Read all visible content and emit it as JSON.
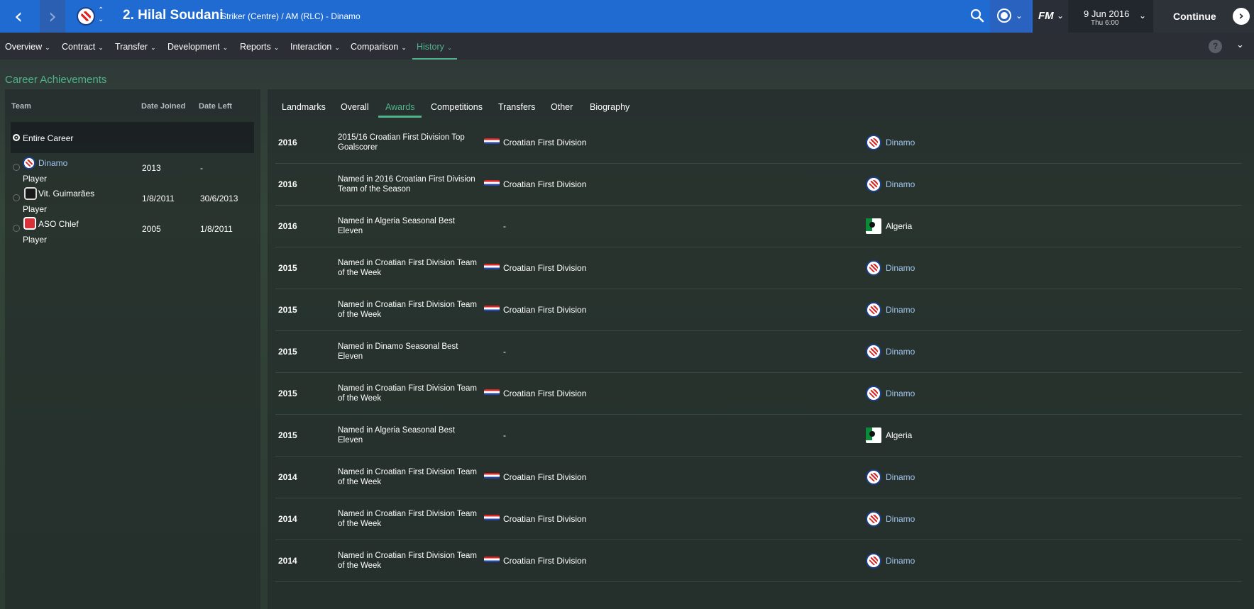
{
  "header": {
    "player_name": "2. Hilal Soudani",
    "player_position": "Striker (Centre) / AM (RLC) - Dinamo",
    "date": "9 Jun 2016",
    "time": "Thu 6:00",
    "continue_label": "Continue",
    "fm_label": "FM"
  },
  "subnav": {
    "items": [
      {
        "label": "Overview"
      },
      {
        "label": "Contract"
      },
      {
        "label": "Transfer"
      },
      {
        "label": "Development"
      },
      {
        "label": "Reports"
      },
      {
        "label": "Interaction"
      },
      {
        "label": "Comparison"
      },
      {
        "label": "History"
      }
    ],
    "active": "History",
    "help_label": "?"
  },
  "page_title": "Career Achievements",
  "left": {
    "columns": {
      "team": "Team",
      "joined": "Date Joined",
      "left": "Date Left"
    },
    "entire_career": "Entire Career",
    "teams": [
      {
        "name": "Dinamo",
        "role": "Player",
        "joined": "2013",
        "left": "-"
      },
      {
        "name": "Vit. Guimarães",
        "role": "Player",
        "joined": "1/8/2011",
        "left": "30/6/2013"
      },
      {
        "name": "ASO Chlef",
        "role": "Player",
        "joined": "2005",
        "left": "1/8/2011"
      }
    ]
  },
  "tabs": [
    "Landmarks",
    "Overall",
    "Awards",
    "Competitions",
    "Transfers",
    "Other",
    "Biography"
  ],
  "active_tab": "Awards",
  "accent_color": "#4fb48a",
  "topbar_color": "#1f6bd1",
  "awards": [
    {
      "year": "2016",
      "desc": "2015/16 Croatian First Division Top Goalscorer",
      "competition": "Croatian First Division",
      "team": "Dinamo"
    },
    {
      "year": "2016",
      "desc": "Named in 2016 Croatian First Division Team of the Season",
      "competition": "Croatian First Division",
      "team": "Dinamo"
    },
    {
      "year": "2016",
      "desc": "Named in Algeria Seasonal Best Eleven",
      "competition": "-",
      "team": "Algeria"
    },
    {
      "year": "2015",
      "desc": "Named in Croatian First Division Team of the Week",
      "competition": "Croatian First Division",
      "team": "Dinamo"
    },
    {
      "year": "2015",
      "desc": "Named in Croatian First Division Team of the Week",
      "competition": "Croatian First Division",
      "team": "Dinamo"
    },
    {
      "year": "2015",
      "desc": "Named in Dinamo Seasonal Best Eleven",
      "competition": "-",
      "team": "Dinamo"
    },
    {
      "year": "2015",
      "desc": "Named in Croatian First Division Team of the Week",
      "competition": "Croatian First Division",
      "team": "Dinamo"
    },
    {
      "year": "2015",
      "desc": "Named in Algeria Seasonal Best Eleven",
      "competition": "-",
      "team": "Algeria"
    },
    {
      "year": "2014",
      "desc": "Named in Croatian First Division Team of the Week",
      "competition": "Croatian First Division",
      "team": "Dinamo"
    },
    {
      "year": "2014",
      "desc": "Named in Croatian First Division Team of the Week",
      "competition": "Croatian First Division",
      "team": "Dinamo"
    },
    {
      "year": "2014",
      "desc": "Named in Croatian First Division Team of the Week",
      "competition": "Croatian First Division",
      "team": "Dinamo"
    }
  ]
}
